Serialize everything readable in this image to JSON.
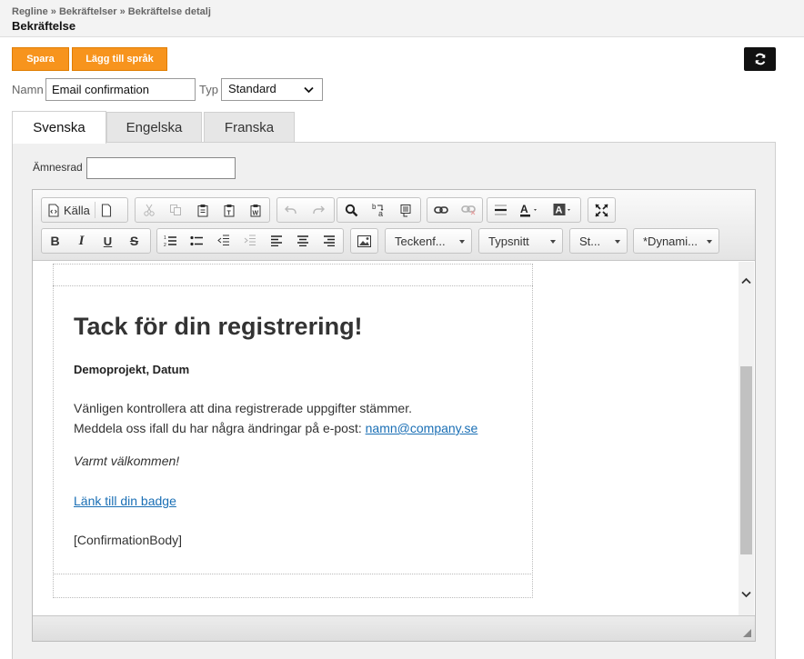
{
  "header": {
    "breadcrumb": "Regline » Bekräftelser » Bekräftelse detalj",
    "title": "Bekräftelse"
  },
  "actions": {
    "save_label": "Spara",
    "add_language_label": "Lägg till språk",
    "refresh_icon": "refresh-icon"
  },
  "form": {
    "name_label": "Namn",
    "name_value": "Email confirmation",
    "type_label": "Typ",
    "type_value": "Standard"
  },
  "tabs": [
    {
      "label": "Svenska",
      "active": true
    },
    {
      "label": "Engelska",
      "active": false
    },
    {
      "label": "Franska",
      "active": false
    }
  ],
  "subject": {
    "label": "Ämnesrad",
    "value": ""
  },
  "toolbar": {
    "source_label": "Källa",
    "font_format_label": "Teckenf...",
    "font_label": "Typsnitt",
    "size_label": "St...",
    "dynamic_label": "*Dynami..."
  },
  "email": {
    "heading": "Tack för din registrering!",
    "subheading": "Demoprojekt, Datum",
    "line1": "Vänligen kontrollera att dina registrerade uppgifter stämmer.",
    "line2_prefix": "Meddela oss ifall du har några ändringar på e-post: ",
    "email_link": "namn@company.se",
    "welcome": "Varmt välkommen!",
    "badge_link": "Länk till din badge",
    "body_placeholder": "[ConfirmationBody]"
  },
  "colors": {
    "accent": "#f7941d",
    "link": "#1a6fb5"
  }
}
